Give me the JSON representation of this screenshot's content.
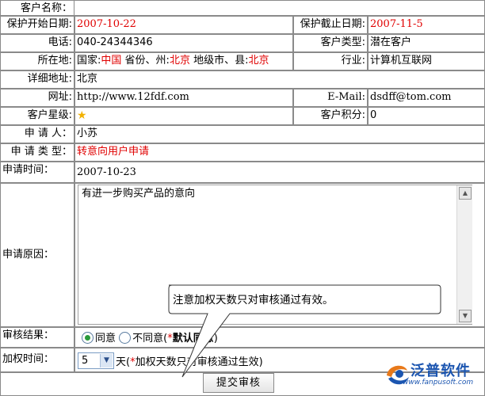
{
  "fields": {
    "customer_name_label": "客户名称：",
    "protect_start_label": "保护开始日期:",
    "protect_start_value": "2007-10-22",
    "protect_end_label": "保护截止日期:",
    "protect_end_value": "2007-11-5",
    "phone_label": "电话:",
    "phone_value": "040-24344346",
    "customer_type_label": "客户类型:",
    "customer_type_value": "潜在客户",
    "location_label": "所在地:",
    "location_country_label": "国家:",
    "location_country_value": "中国",
    "location_province_label": "省份、州:",
    "location_province_value": "北京",
    "location_city_label": "地级市、县:",
    "location_city_value": "北京",
    "industry_label": "行业:",
    "industry_value": "计算机互联网",
    "address_label": "详细地址:",
    "address_value": "北京",
    "website_label": "网址:",
    "website_value": "http://www.12fdf.com",
    "email_label": "E-Mail:",
    "email_value": "dsdff@tom.com",
    "star_label": "客户星级:",
    "points_label": "客户积分:",
    "points_value": "0",
    "applicant_label": "申 请 人：",
    "applicant_value": "小苏",
    "apply_type_label": "申 请 类 型：",
    "apply_type_value": "转意向用户申请",
    "apply_time_label": "申请时间：",
    "apply_time_value": "2007-10-23",
    "apply_reason_label": "申请原因：",
    "apply_reason_value": "有进一步购买产品的意向",
    "review_result_label": "审核结果：",
    "agree_label": "同意",
    "disagree_label": "不同意",
    "default_note_open": "(",
    "default_note_star": "*",
    "default_note_text": "默认同意",
    "default_note_close": ")",
    "weight_time_label": "加权时间：",
    "weight_days_value": "5",
    "weight_days_unit": "天(",
    "weight_note_star": "*",
    "weight_note_text": "加权天数只对审核通过生效)",
    "submit_label": "提交审核"
  },
  "callout": {
    "text": "注意加权天数只对审核通过有效。"
  },
  "logo": {
    "name": "泛普软件",
    "url": "www.fanpusoft.com"
  },
  "colors": {
    "red": "#e00000",
    "brand": "#1b55b0",
    "star": "#f2b100",
    "radio_on": "#2a9a3a"
  },
  "icons": {
    "star": "star-icon",
    "dropdown": "chevron-down-icon",
    "scroll_up": "scroll-up-icon",
    "scroll_down": "scroll-down-icon"
  }
}
